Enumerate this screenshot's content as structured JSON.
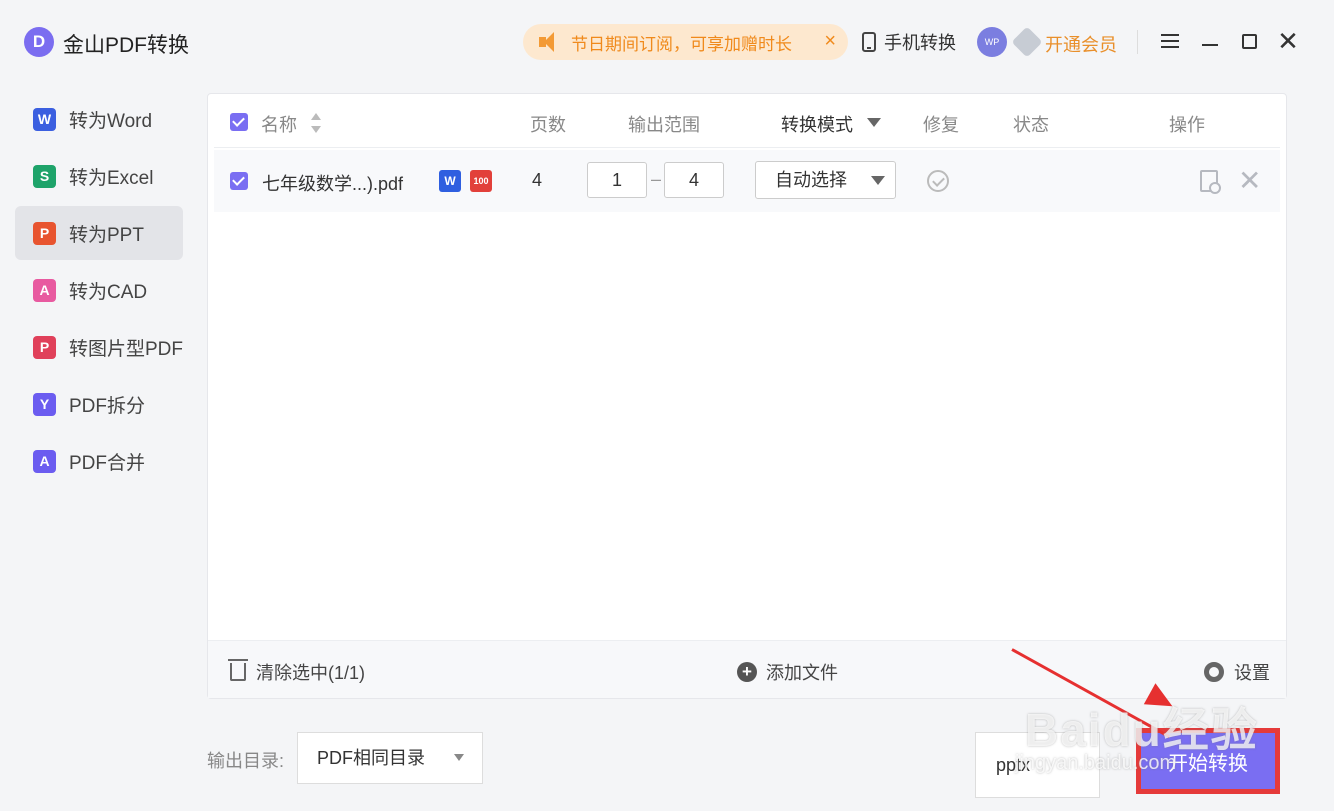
{
  "app": {
    "logo_letter": "D",
    "title": "金山PDF转换"
  },
  "header": {
    "promo_text": "节日期间订阅，可享加赠时长",
    "promo_close": "×",
    "mobile_convert": "手机转换",
    "avatar_text": "WP",
    "vip_label": "开通会员",
    "close_glyph": "✕"
  },
  "sidebar": {
    "items": [
      {
        "label": "转为Word",
        "icon_letter": "W",
        "color": "#3b5fe0"
      },
      {
        "label": "转为Excel",
        "icon_letter": "S",
        "color": "#1ea36a"
      },
      {
        "label": "转为PPT",
        "icon_letter": "P",
        "color": "#e8542f",
        "active": true
      },
      {
        "label": "转为CAD",
        "icon_letter": "A",
        "color": "#e85aa0"
      },
      {
        "label": "转图片型PDF",
        "icon_letter": "P",
        "color": "#e0405a"
      },
      {
        "label": "PDF拆分",
        "icon_letter": "Y",
        "color": "#6b5cf0"
      },
      {
        "label": "PDF合并",
        "icon_letter": "A",
        "color": "#6b5cf0"
      }
    ]
  },
  "table": {
    "headers": {
      "name": "名称",
      "pages": "页数",
      "range": "输出范围",
      "mode": "转换模式",
      "repair": "修复",
      "status": "状态",
      "action": "操作"
    },
    "rows": [
      {
        "filename": "七年级数学...).pdf",
        "badge_w": "W",
        "badge_100": "100",
        "pages": "4",
        "range_from": "1",
        "range_sep": "–",
        "range_to": "4",
        "mode": "自动选择",
        "remove_glyph": "✕"
      }
    ]
  },
  "panel_footer": {
    "clear_selected": "清除选中(1/1)",
    "add_file": "添加文件",
    "plus_glyph": "+",
    "settings": "设置"
  },
  "bottom": {
    "output_dir_label": "输出目录:",
    "output_dir_value": "PDF相同目录",
    "format_value": "pptx",
    "start_button": "开始转换"
  },
  "watermark": {
    "text": "Baidu经验",
    "sub": "jingyan.baidu.com"
  },
  "colors": {
    "accent": "#7a6ef2",
    "promo_bg": "#fde8cf",
    "promo_text": "#f08a1c",
    "highlight": "#e53a3a"
  }
}
